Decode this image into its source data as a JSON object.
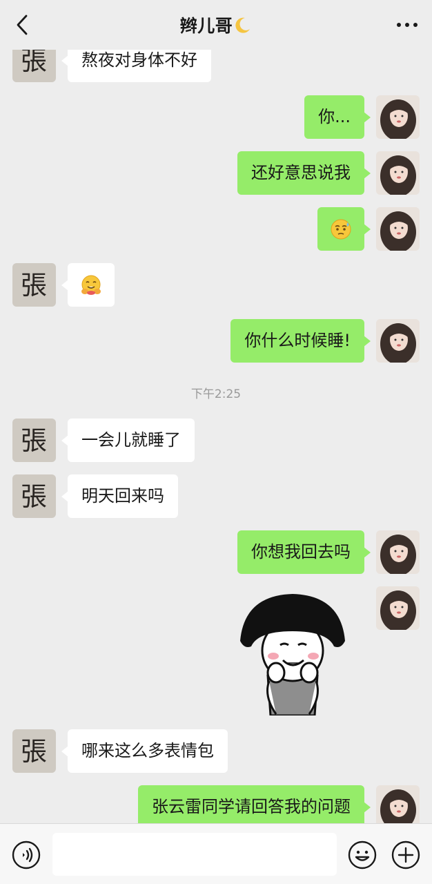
{
  "header": {
    "title": "辫儿哥",
    "back_icon": "chevron-left-icon",
    "more_icon": "more-dots-icon"
  },
  "messages": [
    {
      "side": "left",
      "text": "熬夜对身体不好"
    },
    {
      "side": "right",
      "text": "你..."
    },
    {
      "side": "right",
      "text": "还好意思说我"
    },
    {
      "side": "right",
      "emoji": "anxious-sweat-emoji"
    },
    {
      "side": "left",
      "emoji": "hugging-face-emoji"
    },
    {
      "side": "right",
      "text": "你什么时候睡!"
    },
    {
      "side": "left",
      "text": "一会儿就睡了"
    },
    {
      "side": "left",
      "text": "明天回来吗"
    },
    {
      "side": "right",
      "text": "你想我回去吗"
    },
    {
      "side": "right",
      "sticker": "mushroom-head-meme-sticker"
    },
    {
      "side": "left",
      "text": "哪来这么多表情包"
    },
    {
      "side": "right",
      "text": "张云雷同学请回答我的问题"
    }
  ],
  "timestamp": "下午2:25",
  "avatars": {
    "left": {
      "label": "張",
      "desc": "calligraphy-avatar"
    },
    "right": {
      "desc": "illustrated-girl-avatar"
    }
  },
  "input_bar": {
    "voice_icon": "voice-icon",
    "emoji_icon": "smiley-icon",
    "plus_icon": "plus-icon",
    "placeholder": ""
  },
  "colors": {
    "background": "#ededed",
    "right_bubble": "#95ec69",
    "left_bubble": "#ffffff",
    "timestamp": "#999999"
  }
}
